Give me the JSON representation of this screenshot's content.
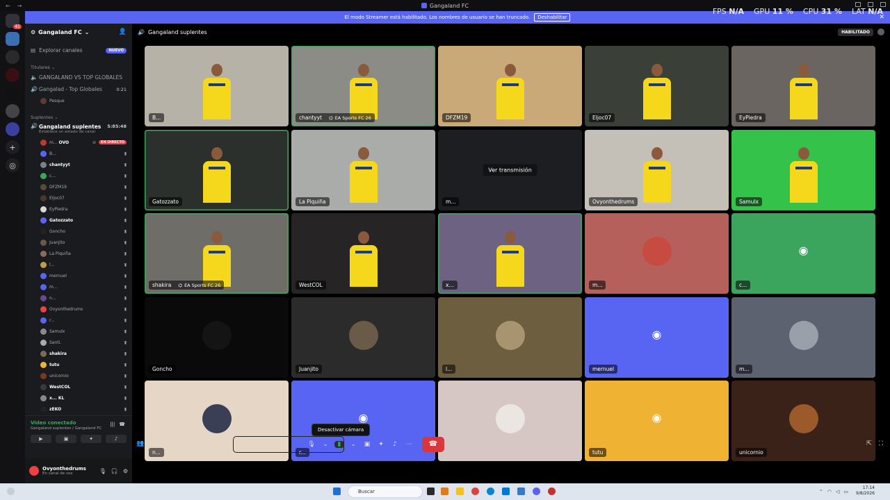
{
  "window": {
    "title": "Gangaland FC"
  },
  "perf": {
    "fps_label": "FPS",
    "fps": "N/A",
    "gpu_label": "GPU",
    "gpu": "11 %",
    "cpu_label": "CPU",
    "cpu": "31 %",
    "lat_label": "LAT",
    "lat": "N/A"
  },
  "banner": {
    "text": "El modo Streamer está habilitado. Los nombres de usuario se han truncado.",
    "button": "Deshabilitar"
  },
  "server": {
    "name": "Gangaland FC"
  },
  "explore": {
    "label": "Explorar canales",
    "badge": "NUEVO"
  },
  "categories": {
    "titulares": "Titulares",
    "suplentes": "Suplentes"
  },
  "channels_top": [
    {
      "name": "GANGALAND VS TOP GLOBALES",
      "time": ""
    },
    {
      "name": "Gangalad - Top Globales",
      "time": "0:21"
    }
  ],
  "top_user": "Pesque",
  "active_channel": {
    "name": "Gangaland suplentes",
    "time": "5:85:48",
    "status": "Establece un estado de canal"
  },
  "voice_users": [
    {
      "name": "m...",
      "tag": "OVO",
      "live": "EN DIRECTO",
      "color": "#c0392b"
    },
    {
      "name": "B...",
      "color": "#5865f2"
    },
    {
      "name": "chantyyt",
      "color": "#7a7f88",
      "bold": true
    },
    {
      "name": "c...",
      "color": "#3ba55d"
    },
    {
      "name": "DFZM19",
      "color": "#5a4a3a"
    },
    {
      "name": "Eljoc07",
      "color": "#4a3a2a"
    },
    {
      "name": "EyPiedra",
      "color": "#d8d8d8"
    },
    {
      "name": "Gatozzato",
      "color": "#5865f2",
      "bold": true
    },
    {
      "name": "Goncho",
      "color": "#222"
    },
    {
      "name": "Juanjito",
      "color": "#6b5a4a"
    },
    {
      "name": "La Piquiña",
      "color": "#8a6a5a"
    },
    {
      "name": "l...",
      "color": "#c59a4a"
    },
    {
      "name": "mernuel",
      "color": "#5865f2"
    },
    {
      "name": "m...",
      "color": "#5865f2"
    },
    {
      "name": "n...",
      "color": "#6a4a8a"
    },
    {
      "name": "Ovyonthedrums",
      "color": "#f23f43"
    },
    {
      "name": "r...",
      "color": "#5865f2"
    },
    {
      "name": "Samulx",
      "color": "#8a8a8a"
    },
    {
      "name": "Santi.",
      "color": "#aaa"
    },
    {
      "name": "shakira",
      "color": "#7a6a5a",
      "bold": true
    },
    {
      "name": "tutu",
      "color": "#f0b232",
      "bold": true
    },
    {
      "name": "unicornio",
      "color": "#7a3a1a"
    },
    {
      "name": "WestCOL",
      "color": "#3a3a3a",
      "bold": true
    },
    {
      "name": "x...",
      "tag": "KL",
      "color": "#888",
      "bold": true
    },
    {
      "name": "zEKO",
      "color": "#222",
      "bold": true
    }
  ],
  "voice_panel": {
    "title": "Video conectado",
    "subtitle": "Gangaland suplentes / Gangaland FC"
  },
  "user_panel": {
    "name": "Ovyonthedrums",
    "status": "En canal de voz"
  },
  "main_header": {
    "channel": "Gangaland suplentes",
    "tag": "HABILITADO"
  },
  "tiles": [
    {
      "label": "B...",
      "kind": "cam",
      "bg": "#b7b2a8"
    },
    {
      "label": "chantyyt",
      "activity": "EA Sports FC 26",
      "kind": "cam",
      "bg": "#8c8c86",
      "speaking": true
    },
    {
      "label": "DFZM19",
      "kind": "cam",
      "bg": "#c8a977"
    },
    {
      "label": "Eljoc07",
      "kind": "cam",
      "bg": "#3a4038"
    },
    {
      "label": "EyPiedra",
      "kind": "cam",
      "bg": "#6a6560"
    },
    {
      "label": "Gatozzato",
      "kind": "cam",
      "bg": "#2c302c",
      "speaking": true
    },
    {
      "label": "La Piquiña",
      "kind": "cam",
      "bg": "#a9aca8"
    },
    {
      "label": "m...",
      "kind": "stream",
      "watch": "Ver transmisión",
      "bg": "#1c1e22"
    },
    {
      "label": "Ovyonthedrums",
      "kind": "cam",
      "bg": "#c4bfb7"
    },
    {
      "label": "Samulx",
      "kind": "cam",
      "bg": "#35c24a"
    },
    {
      "label": "shakira",
      "activity": "EA Sports FC 26",
      "kind": "cam",
      "bg": "#6f6d68",
      "speaking": true
    },
    {
      "label": "WestCOL",
      "kind": "cam",
      "bg": "#262424"
    },
    {
      "label": "x...",
      "kind": "cam",
      "bg": "#6e6283",
      "speaking": true
    },
    {
      "label": "m...",
      "kind": "avatar",
      "bg": "#b5605a",
      "avbg": "#c74b40"
    },
    {
      "label": "c...",
      "kind": "discord",
      "bg": "#3ba55d"
    },
    {
      "label": "Goncho",
      "kind": "avatar",
      "bg": "#0a0a0a",
      "avbg": "#141414"
    },
    {
      "label": "Juanjito",
      "kind": "avatar",
      "bg": "#2b2b2b",
      "avbg": "#6a5a48"
    },
    {
      "label": "l...",
      "kind": "avatar",
      "bg": "#6e5e40",
      "avbg": "#a8956f"
    },
    {
      "label": "mernuel",
      "kind": "discord",
      "bg": "#5865f2"
    },
    {
      "label": "m...",
      "kind": "avatar",
      "bg": "#5c6270",
      "avbg": "#9aa0aa"
    },
    {
      "label": "n...",
      "kind": "avatar",
      "bg": "#e6d6c6",
      "avbg": "#3a3f55"
    },
    {
      "label": "r...",
      "kind": "discord",
      "bg": "#5865f2"
    },
    {
      "label": "",
      "kind": "avatar",
      "bg": "#d6c6c4",
      "avbg": "#ece6e2"
    },
    {
      "label": "tutu",
      "kind": "discord",
      "bg": "#f0b232"
    },
    {
      "label": "unicornio",
      "kind": "avatar",
      "bg": "#3a2218",
      "avbg": "#9c5a2a"
    }
  ],
  "tooltip": "Desactivar cámara",
  "taskbar": {
    "search": "Buscar",
    "time": "17:14",
    "date": "9/8/2026"
  }
}
